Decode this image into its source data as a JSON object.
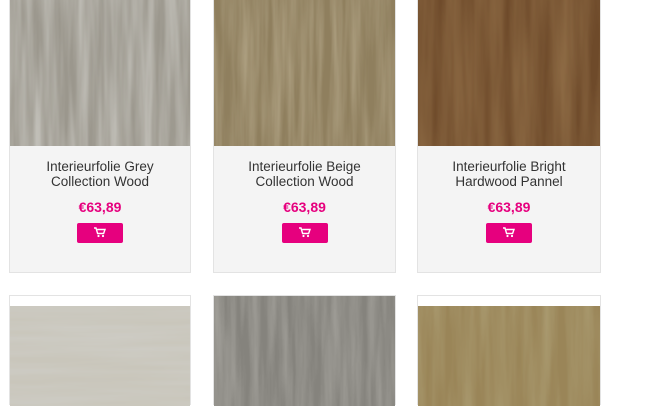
{
  "products": [
    {
      "title_line1": "Interieurfolie Grey",
      "title_line2": "Collection Wood",
      "price": "€63,89",
      "cart_icon": "shopping-cart-icon",
      "swatch_color": "#9b978d"
    },
    {
      "title_line1": "Interieurfolie Beige",
      "title_line2": "Collection Wood",
      "price": "€63,89",
      "cart_icon": "shopping-cart-icon",
      "swatch_color": "#8f7f5e"
    },
    {
      "title_line1": "Interieurfolie Bright",
      "title_line2": "Hardwood Pannel",
      "price": "€63,89",
      "cart_icon": "shopping-cart-icon",
      "swatch_color": "#6e4a2a"
    },
    {
      "swatch_color": "#c9c6bb"
    },
    {
      "swatch_color": "#85837d"
    },
    {
      "swatch_color": "#9a8558"
    }
  ],
  "colors": {
    "accent": "#e6007e"
  }
}
